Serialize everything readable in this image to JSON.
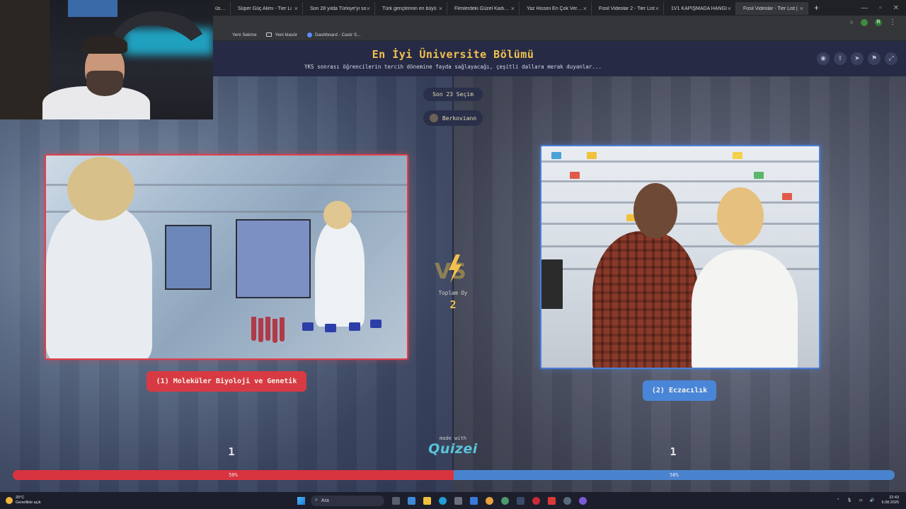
{
  "browser": {
    "tabs": [
      {
        "title": "üsmlü"
      },
      {
        "title": "Süper Güç Alimı - Tier Li"
      },
      {
        "title": "Son 28 yılda Türkiye'yi so"
      },
      {
        "title": "Türk gençlerinin en büyü"
      },
      {
        "title": "Filmlerdeki Güzel Kadınlar"
      },
      {
        "title": "Yaz Hissini En Çok Veren Ş"
      },
      {
        "title": "Fosil Videolar 2 - Tier List"
      },
      {
        "title": "1V1 KAPIŞMADA HANGİ"
      },
      {
        "title": "Fosil Videolar - Tier List | "
      }
    ],
    "new_tab": "+",
    "profile_initial": "R",
    "bookmarks": [
      {
        "label": "Yeni Sekme"
      },
      {
        "label": "Yeni klasör"
      },
      {
        "label": "Dashboard - Castr S..."
      }
    ]
  },
  "page": {
    "title": "En İyi Üniversite Bölümü",
    "subtitle": "YKS sonrası öğrencilerin tercih dönemine fayda sağlayacağı, çeşitli dallara merak duyanlar...",
    "last_choices": "Son 23 Seçim",
    "username": "Berkoviann",
    "total_label": "Toplam Oy",
    "total_value": "2",
    "left": {
      "label": "(1) Moleküler Biyoloji ve Genetik",
      "votes": "1",
      "percent_text": "50%",
      "percent": 50,
      "color": "#d8343f"
    },
    "right": {
      "label": "(2) Eczacılık",
      "votes": "1",
      "percent_text": "50%",
      "percent": 50,
      "color": "#4a84d0"
    },
    "made_with": "made with",
    "brand": "Quizei",
    "header_icons": [
      "eye-icon",
      "share-icon",
      "send-icon",
      "flag-icon",
      "fullscreen-icon"
    ]
  },
  "taskbar": {
    "weather_temp": "20°C",
    "weather_desc": "Genellikle açık",
    "search_placeholder": "Ara",
    "time": "22:43",
    "date": "5.08.2025"
  }
}
